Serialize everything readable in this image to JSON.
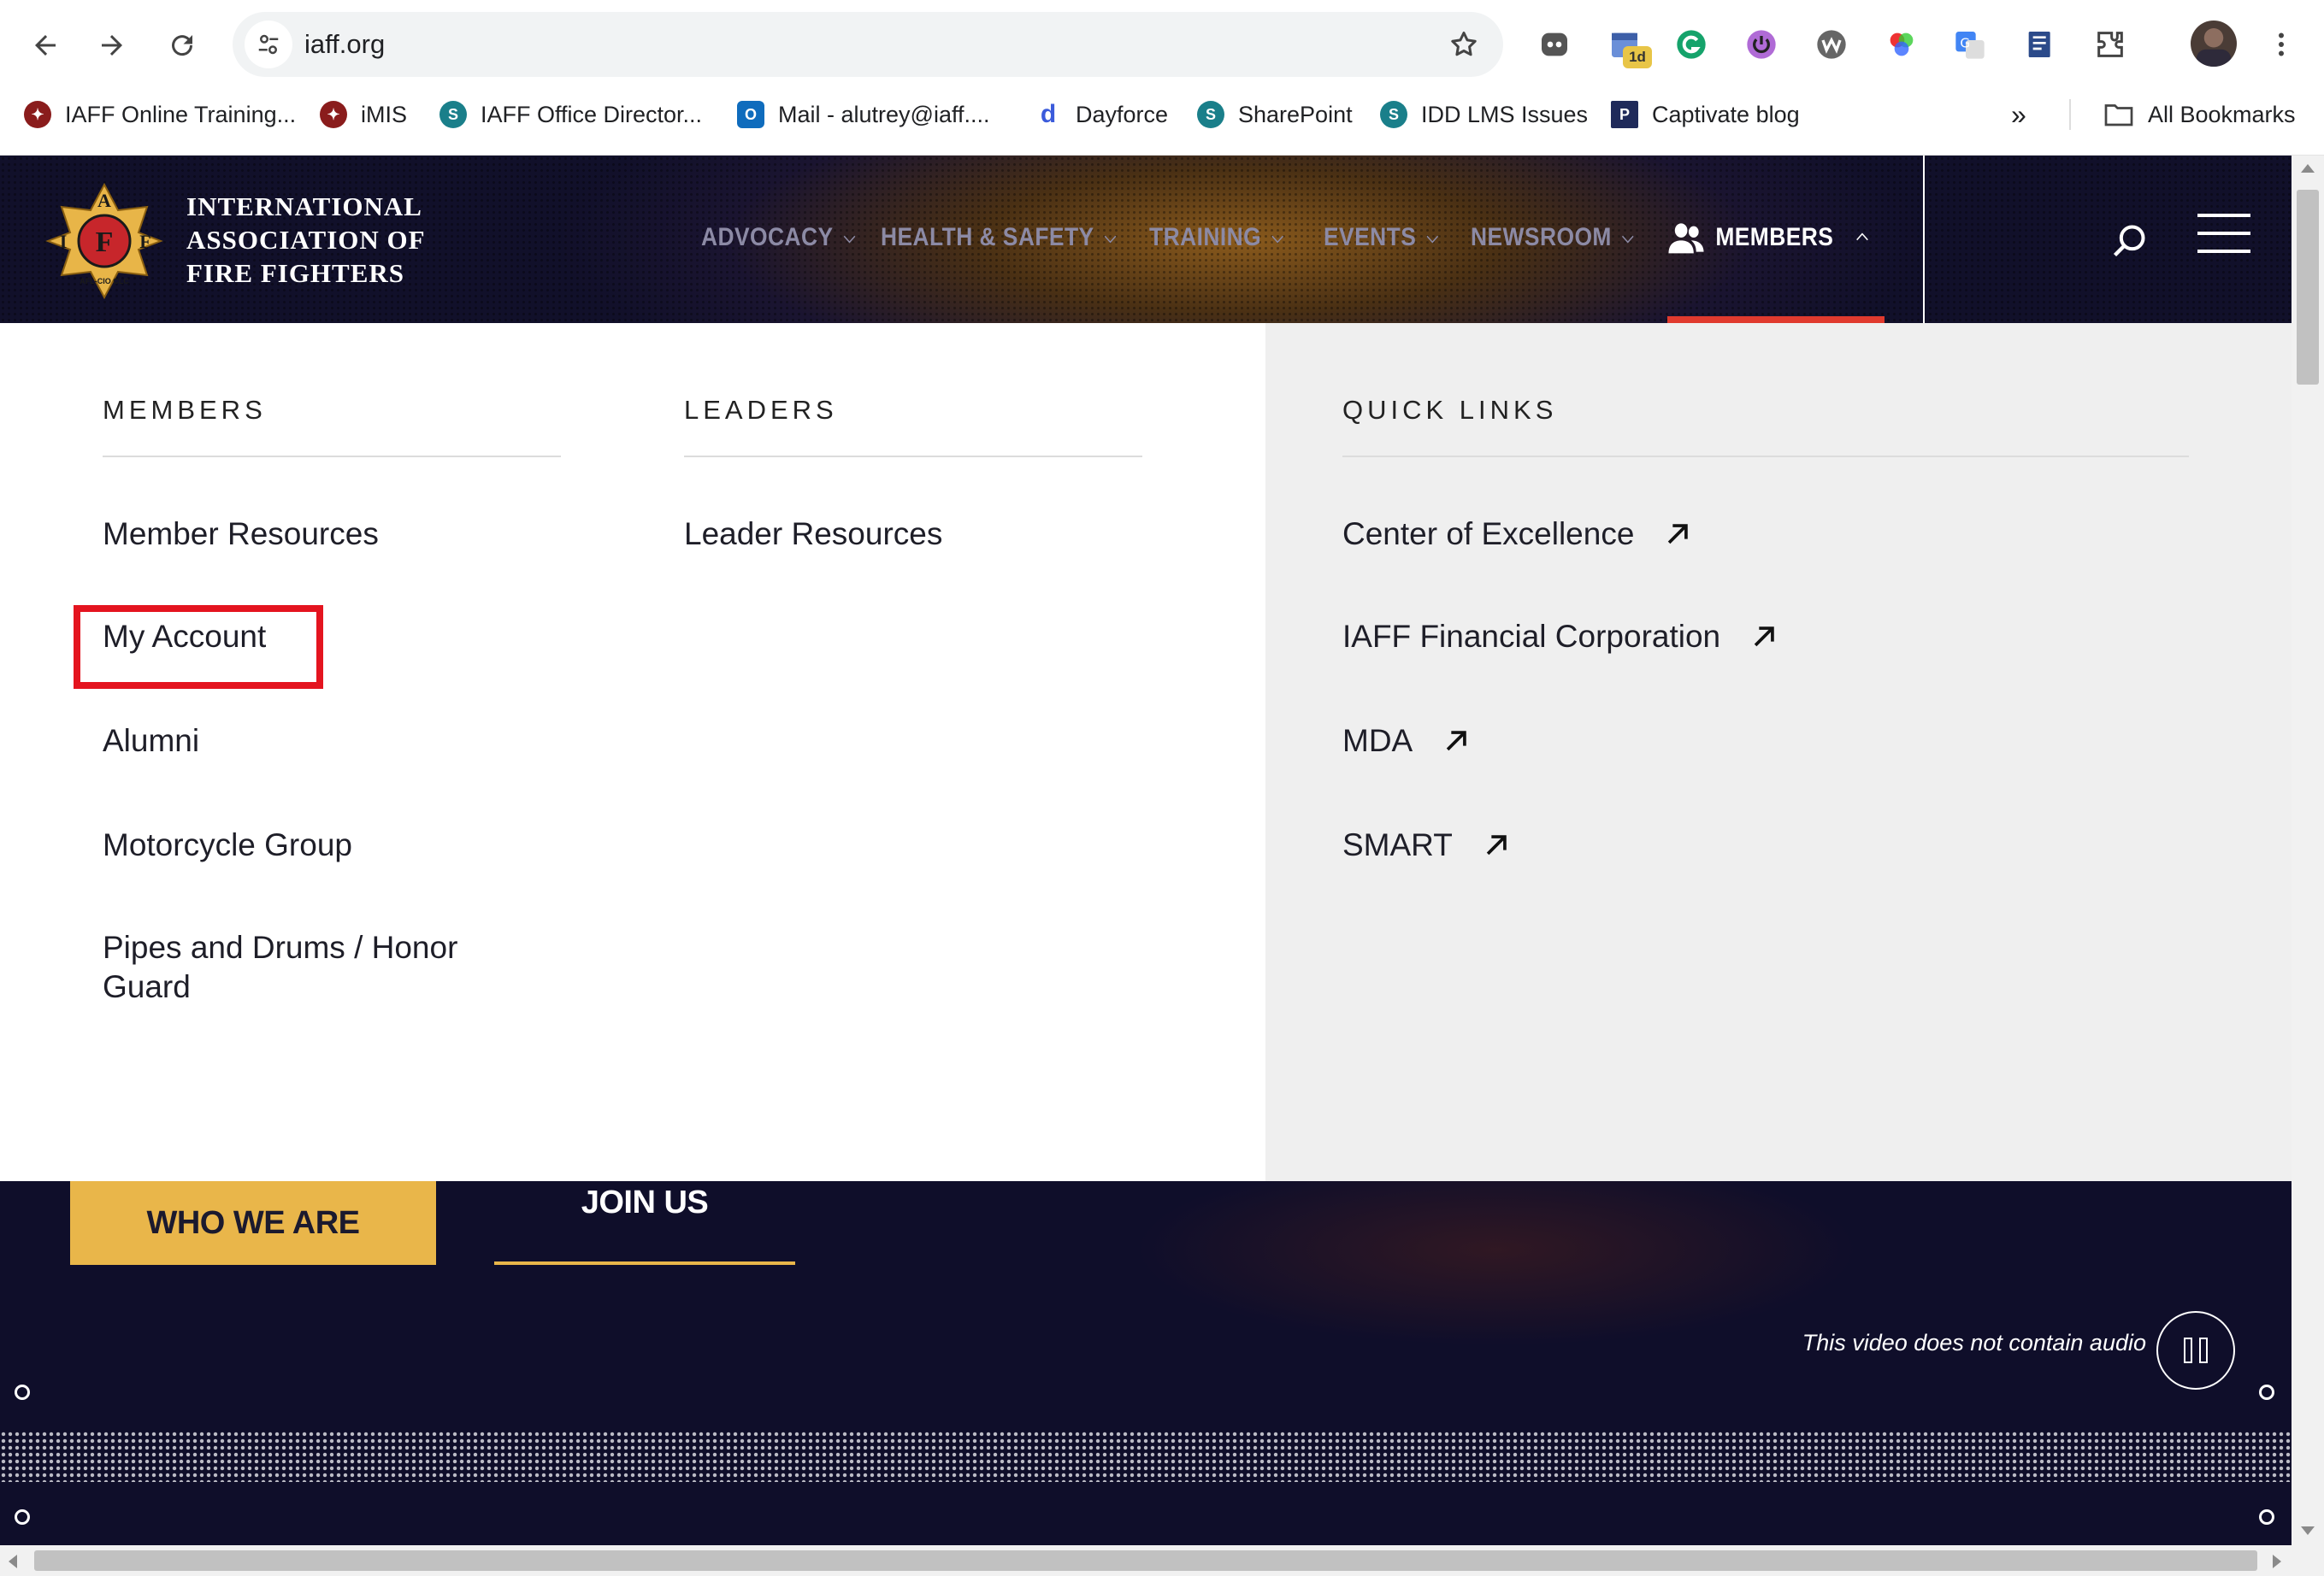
{
  "browser": {
    "url": "iaff.org",
    "bookmarks": [
      {
        "label": "IAFF Online Training...",
        "icon": "iaff-emblem-icon",
        "color": "#8a1c1c"
      },
      {
        "label": "iMIS",
        "icon": "iaff-emblem-icon",
        "color": "#8a1c1c"
      },
      {
        "label": "IAFF Office Director...",
        "icon": "sharepoint-icon",
        "color": "#1a7f8a"
      },
      {
        "label": "Mail - alutrey@iaff....",
        "icon": "outlook-icon",
        "color": "#0f6cbd"
      },
      {
        "label": "Dayforce",
        "icon": "dayforce-icon",
        "color": "#3b5bdb"
      },
      {
        "label": "SharePoint",
        "icon": "sharepoint-icon",
        "color": "#1a7f8a"
      },
      {
        "label": "IDD LMS Issues",
        "icon": "sharepoint-icon",
        "color": "#1a7f8a"
      },
      {
        "label": "Captivate blog",
        "icon": "captivate-icon",
        "color": "#1f2a5a"
      }
    ],
    "all_bookmarks_label": "All Bookmarks",
    "ext_badge": "1d"
  },
  "site": {
    "org_name_lines": [
      "INTERNATIONAL",
      "ASSOCIATION OF",
      "FIRE FIGHTERS"
    ],
    "logo_letters": {
      "top": "A",
      "left": "I",
      "center": "F",
      "right": "F",
      "bottom": "AFL-CIO CLC"
    },
    "nav": [
      {
        "label": "ADVOCACY"
      },
      {
        "label": "HEALTH & SAFETY"
      },
      {
        "label": "TRAINING"
      },
      {
        "label": "EVENTS"
      },
      {
        "label": "NEWSROOM"
      },
      {
        "label": "MEMBERS",
        "active": true
      }
    ],
    "accent": "#e03a2e"
  },
  "mega_menu": {
    "members": {
      "heading": "MEMBERS",
      "links": [
        "Member Resources",
        "My Account",
        "Alumni",
        "Motorcycle Group",
        "Pipes and Drums / Honor Guard"
      ]
    },
    "leaders": {
      "heading": "LEADERS",
      "links": [
        "Leader Resources"
      ]
    },
    "quick_links": {
      "heading": "QUICK LINKS",
      "links": [
        "Center of Excellence",
        "IAFF Financial Corporation",
        "MDA",
        "SMART"
      ]
    },
    "highlight_color": "#e4141f"
  },
  "hero": {
    "who_we_are": "WHO WE ARE",
    "join_us": "JOIN US",
    "video_note": "This video does not contain audio",
    "button_color": "#e9b64a"
  }
}
